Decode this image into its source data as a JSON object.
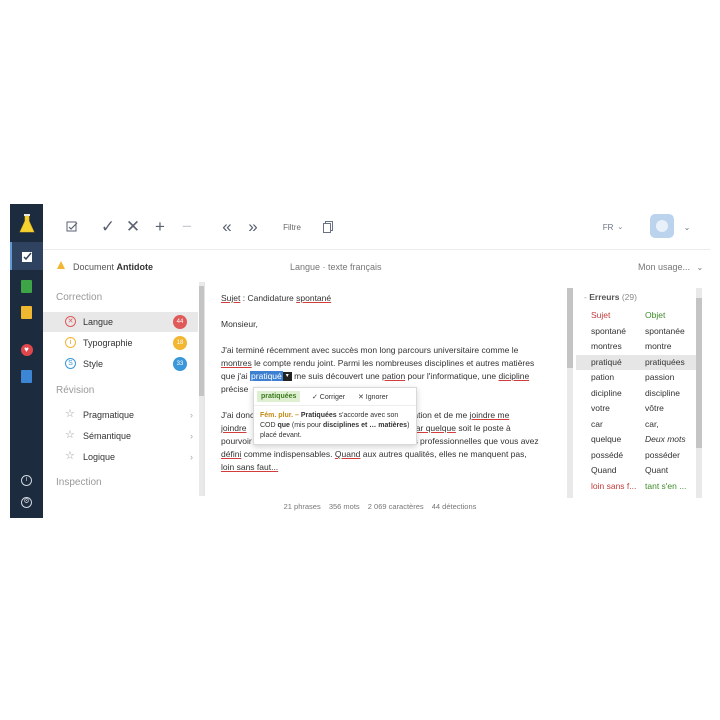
{
  "colors": {
    "rail_bg": "#1d2b3e",
    "error_underline": "#d43c3c",
    "suggestion_green": "#3f8c2a",
    "selection_blue": "#3d7fd1",
    "badge_langue": "#e05a5a",
    "badge_typographie": "#f2b632",
    "badge_style": "#3a97d9"
  },
  "rail": {
    "items": [
      "flask-logo-icon",
      "corrector-icon",
      "dictionary-icon",
      "guide-icon",
      "favorites-icon",
      "book-icon"
    ],
    "bottom": [
      "info-icon",
      "settings-icon"
    ]
  },
  "toolbar": {
    "filter_label": "Filtre",
    "language": "FR",
    "icons": [
      "check-list-icon",
      "accept-icon",
      "reject-icon",
      "add-icon",
      "minus-icon",
      "previous-icon",
      "next-icon",
      "copy-icon",
      "chevron-down-icon"
    ]
  },
  "doc": {
    "prefix": "Document",
    "name": "Antidote",
    "language": "Langue · texte français",
    "usage": "Mon usage..."
  },
  "left": {
    "correction_title": "Correction",
    "correction_items": [
      {
        "label": "Langue",
        "count": "44",
        "color": "#e05a5a",
        "icon": "x-circle-icon"
      },
      {
        "label": "Typographie",
        "count": "18",
        "color": "#f2b632",
        "icon": "info-circle-icon"
      },
      {
        "label": "Style",
        "count": "33",
        "color": "#3a97d9",
        "icon": "s-circle-icon"
      }
    ],
    "revision_title": "Révision",
    "revision_items": [
      {
        "label": "Pragmatique"
      },
      {
        "label": "Sémantique"
      },
      {
        "label": "Logique"
      }
    ],
    "inspection_title": "Inspection"
  },
  "editor": {
    "l1_a": "Sujet",
    "l1_b": " : Candidature ",
    "l1_c": "spontané",
    "l2": "Monsieur,",
    "l3": "J'ai terminé récemment avec succès mon long parcours universitaire comme le",
    "l4_a": "montres",
    "l4_b": " le compte rendu joint. Parmi les nombreuses disciplines et autres matières",
    "l5_a": "que j'ai ",
    "l5_hl": "pratiqué",
    "l5_b": " me suis découvert une ",
    "l5_c": "pation",
    "l5_d": " pour l'informatique, une ",
    "l5_e": "dicipline",
    "l6": "précise",
    "l7_a": "J'ai donc",
    "l7_b": "mation et de me ",
    "l7_c": "joindre me",
    "l8_a": "joindre",
    "l8_b": "car quelque",
    "l8_c": " soit le poste à",
    "l9_a": "pourvoir",
    "l9_b": "és professionnelles que vous avez",
    "l10_a": "défini",
    "l10_b": " comme indispensables. ",
    "l10_c": "Quand",
    "l10_d": " aux autres qualités, elles ne manquent pas,",
    "l11": "loin sans faut..."
  },
  "popup": {
    "suggestion": "pratiquées",
    "fix": "✓ Corriger",
    "ignore": "✕ Ignorer",
    "tag": "Fém. plur. –",
    "t1": "Pratiquées",
    "t2": " s'accorde avec son COD ",
    "t3": "que",
    "t4": " (mis pour ",
    "t5": "disciplines et … matières",
    "t6": ") placé devant."
  },
  "right": {
    "header": "Erreurs",
    "count": "(29)",
    "rows": [
      {
        "w": "Sujet",
        "c": "Objet",
        "wc": "red",
        "cc": "green"
      },
      {
        "w": "spontané",
        "c": "spontanée",
        "wc": "",
        "cc": ""
      },
      {
        "w": "montres",
        "c": "montre",
        "wc": "",
        "cc": ""
      },
      {
        "w": "pratiqué",
        "c": "pratiquées",
        "wc": "",
        "cc": "",
        "sel": true
      },
      {
        "w": "pation",
        "c": "passion",
        "wc": "",
        "cc": ""
      },
      {
        "w": "dicipline",
        "c": "discipline",
        "wc": "",
        "cc": ""
      },
      {
        "w": "votre",
        "c": "vôtre",
        "wc": "",
        "cc": ""
      },
      {
        "w": "car",
        "c": "car,",
        "wc": "",
        "cc": ""
      },
      {
        "w": "quelque",
        "c": "Deux mots",
        "wc": "",
        "cc": "ital"
      },
      {
        "w": "possédé",
        "c": "posséder",
        "wc": "",
        "cc": ""
      },
      {
        "w": "Quand",
        "c": "Quant",
        "wc": "",
        "cc": ""
      },
      {
        "w": "loin sans f...",
        "c": "tant s'en ...",
        "wc": "red",
        "cc": "green"
      }
    ]
  },
  "status": {
    "sentences": "21 phrases",
    "words": "356 mots",
    "chars": "2 069 caractères",
    "detections": "44 détections"
  }
}
